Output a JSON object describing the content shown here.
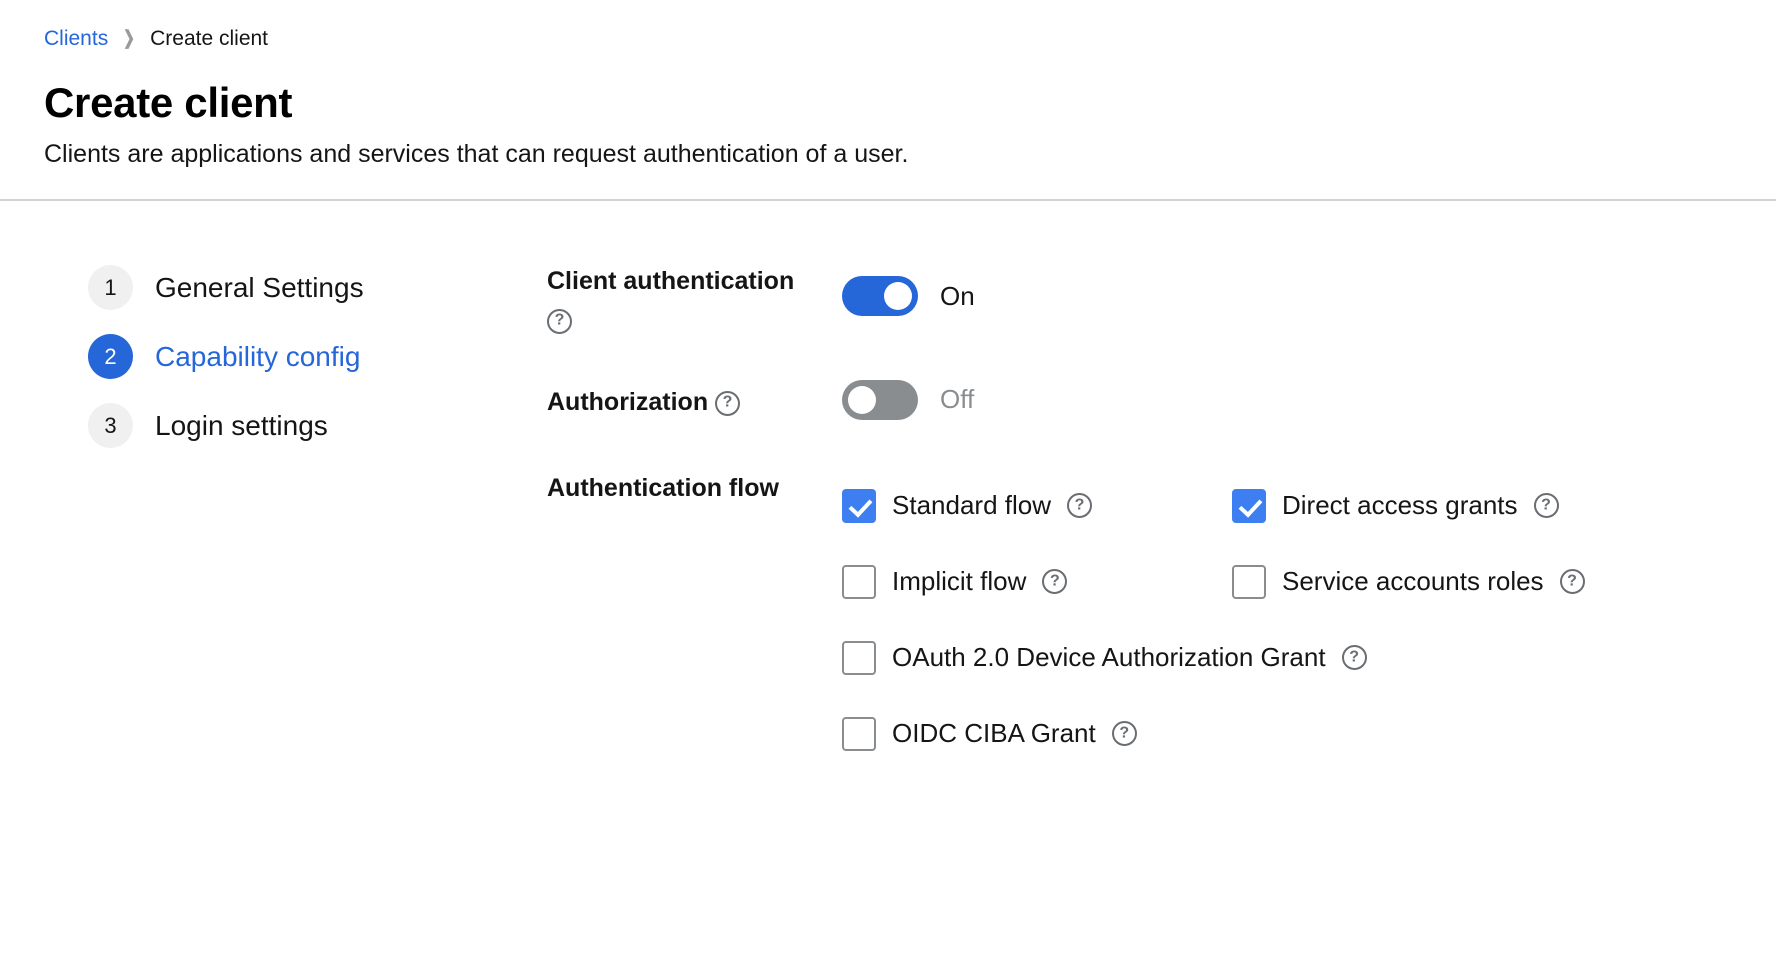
{
  "breadcrumb": {
    "parent": "Clients",
    "separator": "❯",
    "current": "Create client"
  },
  "header": {
    "title": "Create client",
    "subtitle": "Clients are applications and services that can request authentication of a user."
  },
  "wizard": {
    "steps": [
      {
        "number": "1",
        "label": "General Settings",
        "active": false
      },
      {
        "number": "2",
        "label": "Capability config",
        "active": true
      },
      {
        "number": "3",
        "label": "Login settings",
        "active": false
      }
    ]
  },
  "form": {
    "client_authentication": {
      "label": "Client authentication",
      "help_glyph": "?",
      "toggle_state": "on",
      "toggle_text": "On"
    },
    "authorization": {
      "label": "Authorization",
      "help_glyph": "?",
      "toggle_state": "off",
      "toggle_text": "Off"
    },
    "authentication_flow": {
      "label": "Authentication flow",
      "help_glyph": "?",
      "options": [
        {
          "label": "Standard flow",
          "checked": true
        },
        {
          "label": "Direct access grants",
          "checked": true
        },
        {
          "label": "Implicit flow",
          "checked": false
        },
        {
          "label": "Service accounts roles",
          "checked": false
        },
        {
          "label": "OAuth 2.0 Device Authorization Grant",
          "checked": false
        },
        {
          "label": "OIDC CIBA Grant",
          "checked": false
        }
      ]
    }
  },
  "colors": {
    "accent_blue": "#2566d8",
    "checkbox_blue": "#3d7ff0",
    "toggle_off_gray": "#8a8d90",
    "divider_gray": "#d2d2d2",
    "step_badge_gray": "#f0f0f0",
    "help_icon_gray": "#6a6e73"
  }
}
